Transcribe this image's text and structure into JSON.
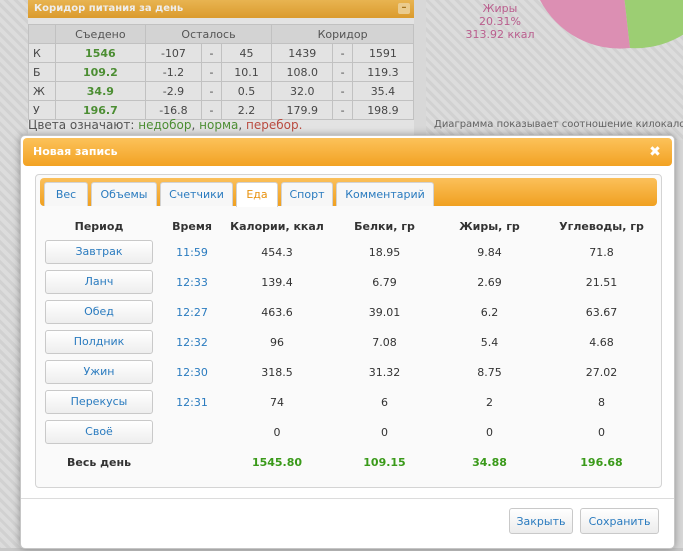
{
  "corridor_panel": {
    "title": "Коридор питания за день",
    "headers": [
      "",
      "Съедено",
      "Осталось",
      "",
      "Коридор",
      "",
      ""
    ],
    "rows": [
      {
        "letter": "К",
        "eaten": "1546",
        "left_min": "-107",
        "dash1": "-",
        "left_max": "45",
        "corr_min": "1439",
        "dash2": "-",
        "corr_max": "1591"
      },
      {
        "letter": "Б",
        "eaten": "109.2",
        "left_min": "-1.2",
        "dash1": "-",
        "left_max": "10.1",
        "corr_min": "108.0",
        "dash2": "-",
        "corr_max": "119.3"
      },
      {
        "letter": "Ж",
        "eaten": "34.9",
        "left_min": "-2.9",
        "dash1": "-",
        "left_max": "0.5",
        "corr_min": "32.0",
        "dash2": "-",
        "corr_max": "35.4"
      },
      {
        "letter": "У",
        "eaten": "196.7",
        "left_min": "-16.8",
        "dash1": "-",
        "left_max": "2.2",
        "corr_min": "179.9",
        "dash2": "-",
        "corr_max": "198.9"
      }
    ],
    "legend_prefix": "Цвета означают:",
    "legend_under": "недобор",
    "legend_norm": "норма",
    "legend_over": "перебор."
  },
  "pie": {
    "label_name": "Жиры",
    "label_percent": "20.31%",
    "label_kcal": "313.92 ккал",
    "caption": "Диаграмма показывает соотношение килокалорий",
    "colors": {
      "fat": "#e98bb7",
      "green": "#9bd86a"
    }
  },
  "modal": {
    "title": "Новая запись",
    "close_glyph": "✖",
    "tabs": [
      "Вес",
      "Объемы",
      "Счетчики",
      "Еда",
      "Спорт",
      "Комментарий"
    ],
    "active_tab": "Еда",
    "columns": [
      "Период",
      "Время",
      "Калории, ккал",
      "Белки, гр",
      "Жиры, гр",
      "Углеводы, гр"
    ],
    "meals": [
      {
        "period": "Завтрак",
        "time": "11:59",
        "kcal": "454.3",
        "protein": "18.95",
        "fat": "9.84",
        "carbs": "71.8"
      },
      {
        "period": "Ланч",
        "time": "12:33",
        "kcal": "139.4",
        "protein": "6.79",
        "fat": "2.69",
        "carbs": "21.51"
      },
      {
        "period": "Обед",
        "time": "12:27",
        "kcal": "463.6",
        "protein": "39.01",
        "fat": "6.2",
        "carbs": "63.67"
      },
      {
        "period": "Полдник",
        "time": "12:32",
        "kcal": "96",
        "protein": "7.08",
        "fat": "5.4",
        "carbs": "4.68"
      },
      {
        "period": "Ужин",
        "time": "12:30",
        "kcal": "318.5",
        "protein": "31.32",
        "fat": "8.75",
        "carbs": "27.02"
      },
      {
        "period": "Перекусы",
        "time": "12:31",
        "kcal": "74",
        "protein": "6",
        "fat": "2",
        "carbs": "8"
      },
      {
        "period": "Своё",
        "time": "",
        "kcal": "0",
        "protein": "0",
        "fat": "0",
        "carbs": "0"
      }
    ],
    "total": {
      "label": "Весь день",
      "kcal": "1545.80",
      "protein": "109.15",
      "fat": "34.88",
      "carbs": "196.68"
    },
    "close_button": "Закрыть",
    "save_button": "Сохранить"
  },
  "colors": {
    "accent": "#f5a623",
    "link": "#2a7bbf",
    "green": "#3a9a1a",
    "red": "#c0392b"
  }
}
